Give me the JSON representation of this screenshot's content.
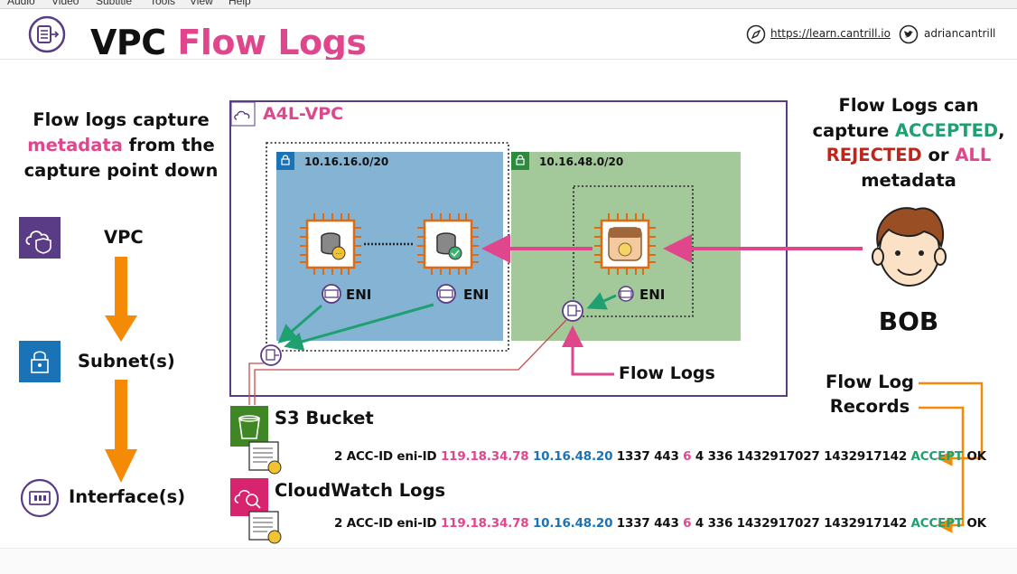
{
  "menubar": [
    "Audio",
    "Video",
    "Subtitle",
    "Tools",
    "View",
    "Help"
  ],
  "header": {
    "title_main": "VPC ",
    "title_accent": "Flow Logs",
    "link_url": "https://learn.cantrill.io",
    "twitter_handle": "adriancantrill"
  },
  "left_panel": {
    "intro_line1": "Flow logs capture",
    "intro_line2_accent": "metadata",
    "intro_line2_rest": " from the",
    "intro_line3": "capture point down",
    "levels": [
      "VPC",
      "Subnet(s)",
      "Interface(s)"
    ]
  },
  "vpc": {
    "name": "A4L-VPC",
    "subnet_blue_cidr": "10.16.16.0/20",
    "subnet_green_cidr": "10.16.48.0/20",
    "eni_label": "ENI",
    "flow_logs_label": "Flow Logs"
  },
  "right_panel": {
    "line1": "Flow Logs can",
    "line2_prefix": "capture ",
    "line2_accepted": "ACCEPTED",
    "line2_suffix": ",",
    "line3_rejected": "REJECTED",
    "line3_or": " or ",
    "line3_all": "ALL",
    "line4": "metadata",
    "person": "BOB",
    "records_line1": "Flow Log",
    "records_line2": "Records"
  },
  "destinations": {
    "s3": "S3 Bucket",
    "cloudwatch": "CloudWatch Logs"
  },
  "log_record": {
    "prefix": "2 ACC-ID eni-ID ",
    "src_ip": "119.18.34.78",
    "dst_ip": "10.16.48.20",
    "ports": " 1337 443 ",
    "protocol": "6",
    "rest": " 4 336 1432917027 1432917142 ",
    "action": "ACCEPT",
    "status": " OK"
  },
  "colors": {
    "pink": "#e0468c",
    "green": "#1fa070",
    "red": "#c0251b",
    "blue": "#1a73b7",
    "orange": "#f58a07",
    "vpc_border": "#5a3c86",
    "subnet_blue": "#84b3d4",
    "subnet_green": "#a3c99a"
  }
}
